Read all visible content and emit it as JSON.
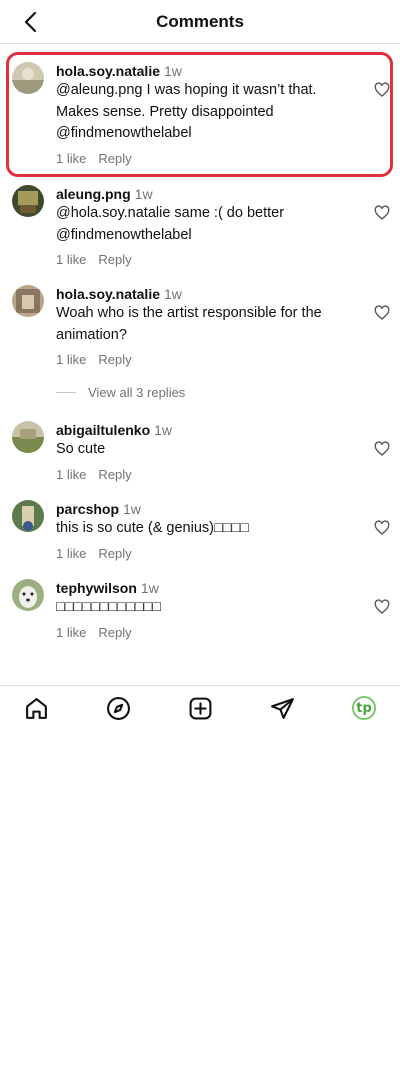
{
  "header": {
    "title": "Comments"
  },
  "comments": [
    {
      "username": "hola.soy.natalie",
      "time": "1w",
      "text": "@aleung.png I was hoping it wasn’t that. Makes sense. Pretty disappointed @findmenowthelabel",
      "likes": "1 like",
      "reply": "Reply"
    },
    {
      "username": "aleung.png",
      "time": "1w",
      "text": "@hola.soy.natalie same :( do better @findmenowthelabel",
      "likes": "1 like",
      "reply": "Reply"
    },
    {
      "username": "hola.soy.natalie",
      "time": "1w",
      "text": "Woah who is the artist responsible for the animation?",
      "likes": "1 like",
      "reply": "Reply"
    },
    {
      "username": "abigailtulenko",
      "time": "1w",
      "text": "So cute",
      "likes": "1 like",
      "reply": "Reply"
    },
    {
      "username": "parcshop",
      "time": "1w",
      "text": "this is so cute (& genius)□□□□",
      "likes": "1 like",
      "reply": "Reply"
    },
    {
      "username": "tephywilson",
      "time": "1w",
      "text": "□□□□□□□□□□□□",
      "likes": "1 like",
      "reply": "Reply"
    }
  ],
  "view_replies": "View all 3 replies",
  "tabbar": {
    "icons": [
      "home-icon",
      "explore-icon",
      "create-icon",
      "direct-message-icon",
      "profile-avatar"
    ],
    "profile_initials": "tp",
    "profile_color": "#7cc46f"
  },
  "colors": {
    "highlight": "#e0303c",
    "muted": "#737373"
  }
}
